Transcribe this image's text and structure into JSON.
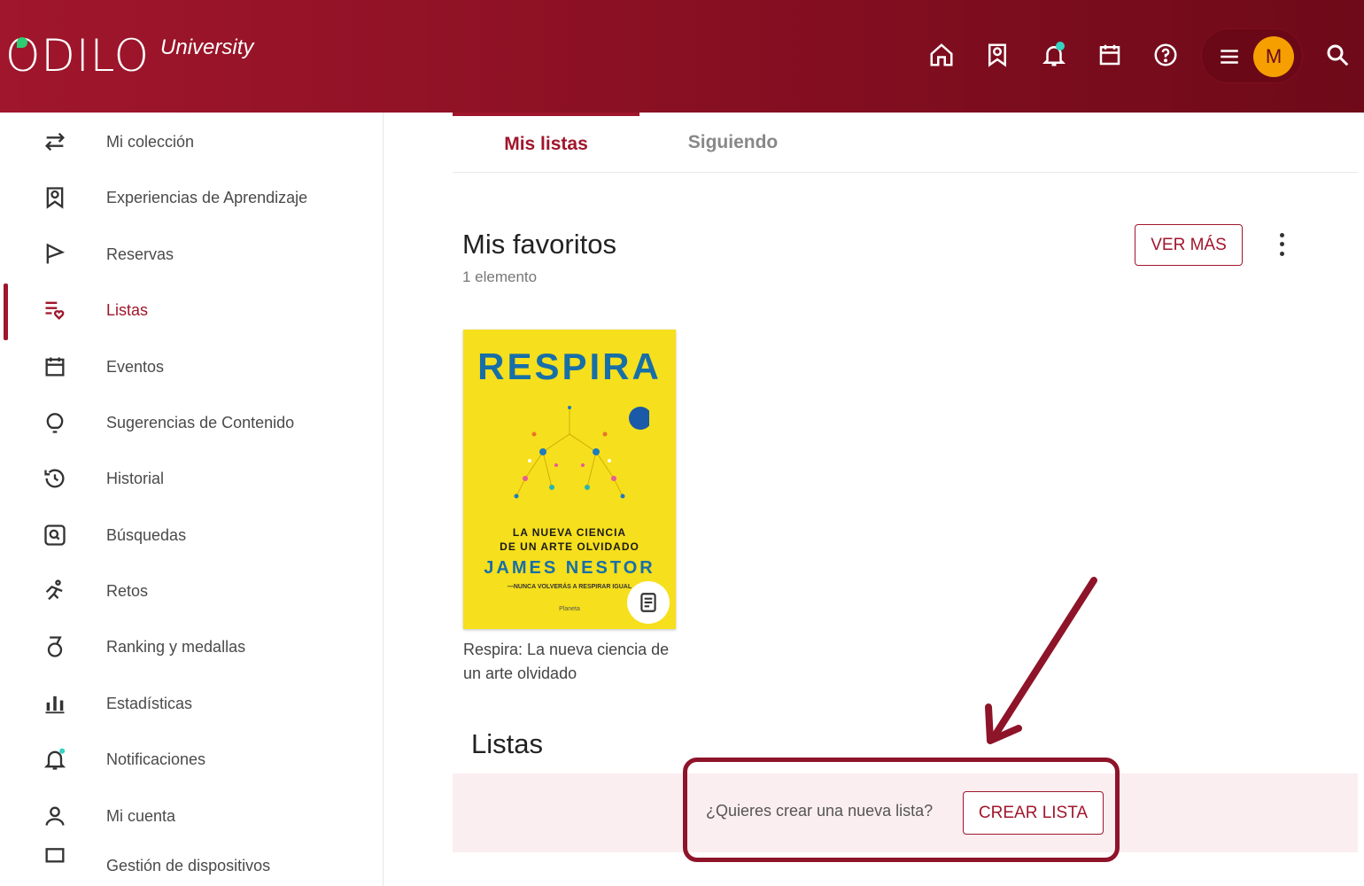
{
  "header": {
    "logo_text": "ODILO",
    "logo_sub": "University",
    "icons": [
      "home-icon",
      "bookmark-ribbon-icon",
      "bell-icon",
      "calendar-icon",
      "help-icon",
      "menu-icon",
      "search-icon"
    ],
    "avatar_initial": "M"
  },
  "sidebar": {
    "items": [
      {
        "label": "Mi colección",
        "icon": "swap-arrows-icon"
      },
      {
        "label": "Experiencias de Aprendizaje",
        "icon": "bookmark-ribbon-icon"
      },
      {
        "label": "Reservas",
        "icon": "flag-icon"
      },
      {
        "label": "Listas",
        "icon": "list-heart-icon",
        "active": true
      },
      {
        "label": "Eventos",
        "icon": "calendar-icon"
      },
      {
        "label": "Sugerencias de Contenido",
        "icon": "lightbulb-icon"
      },
      {
        "label": "Historial",
        "icon": "history-icon"
      },
      {
        "label": "Búsquedas",
        "icon": "search-box-icon"
      },
      {
        "label": "Retos",
        "icon": "runner-icon"
      },
      {
        "label": "Ranking y medallas",
        "icon": "medal-icon"
      },
      {
        "label": "Estadísticas",
        "icon": "bar-chart-icon"
      },
      {
        "label": "Notificaciones",
        "icon": "bell-icon"
      },
      {
        "label": "Mi cuenta",
        "icon": "user-icon"
      },
      {
        "label": "Gestión de dispositivos",
        "icon": "device-icon"
      }
    ]
  },
  "tabs": {
    "mis_listas": "Mis listas",
    "siguiendo": "Siguiendo"
  },
  "favoritos": {
    "title": "Mis favoritos",
    "count": "1 elemento",
    "ver_mas": "VER MÁS"
  },
  "book": {
    "cover_title": "RESPIRA",
    "cover_sub_1": "LA NUEVA CIENCIA",
    "cover_sub_2": "DE UN ARTE OLVIDADO",
    "cover_author": "JAMES NESTOR",
    "cover_quote": "—NUNCA VOLVERÁS A RESPIRAR IGUAL",
    "cover_publisher": "Planeta",
    "caption": "Respira: La nueva ciencia de un arte olvidado"
  },
  "listas": {
    "title": "Listas",
    "question": "¿Quieres crear una nueva lista?",
    "create_button": "CREAR LISTA"
  },
  "colors": {
    "brand": "#a0162c",
    "accent_dot": "#34d3c3",
    "avatar": "#f5a000",
    "book_cover": "#f6df1c"
  }
}
